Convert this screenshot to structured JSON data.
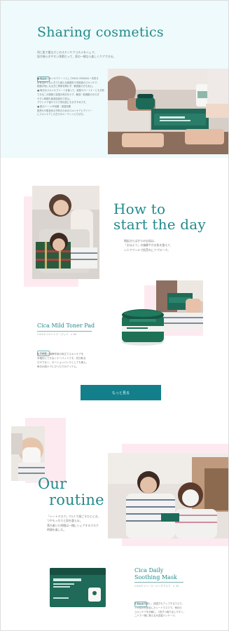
{
  "hero": {
    "title": "Sharing cosmetics",
    "lead": "同じ肌で重なさこのスキンケアコスメをシェア。\n肌が揺らぎやすい季節だって、家の一緒なら楽しくケアできる。",
    "badge": "POINT",
    "body": "■ 毎日のスキンケアシートとしてMILD CREAMの一本書き\n所有感が少ない方でも使える無香料で低刺激のスキンケア。\n乾燥が気になる方に季節を問わず、敏感肌の方も安心。\n■ 毎日のスキンケアシートを使って、家族やパートナーとも共有\nできるこの鎮静と保湿の両方をケア。敏感・乾燥肌のゆらぎ\nやすい時期も無添加設計で安心。\nアウトドア後やマスク荒れ肌にもおすすめです。\n■ 肌のトーンUP効果・保湿効果\n肌荒れや肌老化の予防のためのスキンケアとデイリー\nにスキンケアした日々のルーティンにもぜひ。"
  },
  "how": {
    "title_line1": "How to",
    "title_line2": "start the day",
    "text": "朝起きたばかりのお肌は、\n「おはよう」の鎮静やかお肌を整えて、\n二人でワンルで肌荒れにアプローチ。"
  },
  "toner": {
    "name": "Cica Mild Toner Pad",
    "sub": "CICAマイルドトナーパッド　x 60",
    "badge": "POINT",
    "text": "肌の刺激と鎮静作用の両立でスキンケアを\n本格的にできるトナーパッドです。拭き取る\nだけでなく、ローションパックとしても使え、\n毎日の肌ケアにぴったりのアイテム。"
  },
  "more_button": {
    "label": "もっと見る"
  },
  "routine": {
    "title_line1": "Our",
    "title_line2": "routine",
    "text": "「シートマスク」で2人で過ごすひととき。\nつやもっちりと肌を整える。\n落ち着いた時間は一緒にシェアするマスク\n時間を楽しむ。"
  },
  "mask": {
    "name_line1": "Cica Daily",
    "name_line2": "Soothing Mask",
    "sub": "CICAデイリースージングマスク　x 30",
    "badge": "POINT",
    "text": "肌荒れを鎮静し、保湿力もアップするマスク。\nシカ成分を配合したシートマスクで、毎日の\nスキンケアを手軽に。1枚ずつ取り出しやすく、\n二人で一緒に使える大容量パッケージ。"
  },
  "icons": {
    "cosmetics_photo": "couple-with-cream-photo",
    "pillow_photo": "couple-on-pillow-photo",
    "toner_jar": "toner-pad-jar-photo",
    "mask_photo": "sheet-mask-couple-photo",
    "mask_box": "soothing-mask-box-photo"
  },
  "colors": {
    "accent": "#238a8c",
    "button": "#137f8b",
    "mint": "#eefafb",
    "pink": "#fdeaf0"
  }
}
